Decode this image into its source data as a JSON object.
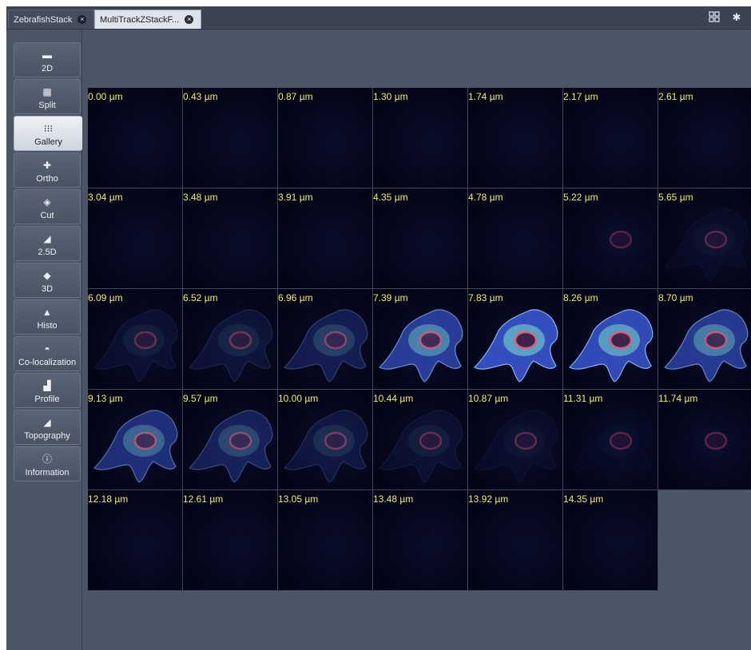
{
  "tabs": [
    {
      "label": "ZebrafishStack",
      "active": false
    },
    {
      "label": "MultiTrackZStackF...",
      "active": true
    }
  ],
  "toolbar_icons": [
    "layout-grid-icon",
    "settings-gear-icon"
  ],
  "sidebar": {
    "items": [
      {
        "label": "2D",
        "icon": "2d-view-icon",
        "active": false
      },
      {
        "label": "Split",
        "icon": "split-view-icon",
        "active": false
      },
      {
        "label": "Gallery",
        "icon": "gallery-grid-icon",
        "active": true
      },
      {
        "label": "Ortho",
        "icon": "ortho-view-icon",
        "active": false
      },
      {
        "label": "Cut",
        "icon": "cut-view-icon",
        "active": false
      },
      {
        "label": "2.5D",
        "icon": "2-5d-view-icon",
        "active": false
      },
      {
        "label": "3D",
        "icon": "3d-view-icon",
        "active": false
      },
      {
        "label": "Histo",
        "icon": "histogram-icon",
        "active": false
      },
      {
        "label": "Co-localization",
        "icon": "colocalization-icon",
        "active": false
      },
      {
        "label": "Profile",
        "icon": "profile-icon",
        "active": false
      },
      {
        "label": "Topography",
        "icon": "topography-icon",
        "active": false
      },
      {
        "label": "Information",
        "icon": "information-icon",
        "active": false
      }
    ]
  },
  "gallery": {
    "tiles": [
      {
        "label": "0.00 µm",
        "signal": 0.0
      },
      {
        "label": "0.43 µm",
        "signal": 0.0
      },
      {
        "label": "0.87 µm",
        "signal": 0.0
      },
      {
        "label": "1.30 µm",
        "signal": 0.0
      },
      {
        "label": "1.74 µm",
        "signal": 0.0
      },
      {
        "label": "2.17 µm",
        "signal": 0.0
      },
      {
        "label": "2.61 µm",
        "signal": 0.0
      },
      {
        "label": "3.04 µm",
        "signal": 0.0
      },
      {
        "label": "3.48 µm",
        "signal": 0.0
      },
      {
        "label": "3.91 µm",
        "signal": 0.0
      },
      {
        "label": "4.35 µm",
        "signal": 0.0
      },
      {
        "label": "4.78 µm",
        "signal": 0.0
      },
      {
        "label": "5.22 µm",
        "signal": 0.02
      },
      {
        "label": "5.65 µm",
        "signal": 0.05
      },
      {
        "label": "6.09 µm",
        "signal": 0.1
      },
      {
        "label": "6.52 µm",
        "signal": 0.15
      },
      {
        "label": "6.96 µm",
        "signal": 0.3
      },
      {
        "label": "7.39 µm",
        "signal": 0.75
      },
      {
        "label": "7.83 µm",
        "signal": 1.0
      },
      {
        "label": "8.26 µm",
        "signal": 0.95
      },
      {
        "label": "8.70 µm",
        "signal": 0.7
      },
      {
        "label": "9.13 µm",
        "signal": 0.55
      },
      {
        "label": "9.57 µm",
        "signal": 0.35
      },
      {
        "label": "10.00 µm",
        "signal": 0.2
      },
      {
        "label": "10.44 µm",
        "signal": 0.1
      },
      {
        "label": "10.87 µm",
        "signal": 0.06
      },
      {
        "label": "11.31 µm",
        "signal": 0.03
      },
      {
        "label": "11.74 µm",
        "signal": 0.02
      },
      {
        "label": "12.18 µm",
        "signal": 0.0
      },
      {
        "label": "12.61 µm",
        "signal": 0.0
      },
      {
        "label": "13.05 µm",
        "signal": 0.0
      },
      {
        "label": "13.48 µm",
        "signal": 0.0
      },
      {
        "label": "13.92 µm",
        "signal": 0.0
      },
      {
        "label": "14.35 µm",
        "signal": 0.0
      }
    ]
  },
  "colors": {
    "label_yellow": "#f2ef55",
    "background": "#4c5566",
    "tile_border": "#3c4860"
  }
}
